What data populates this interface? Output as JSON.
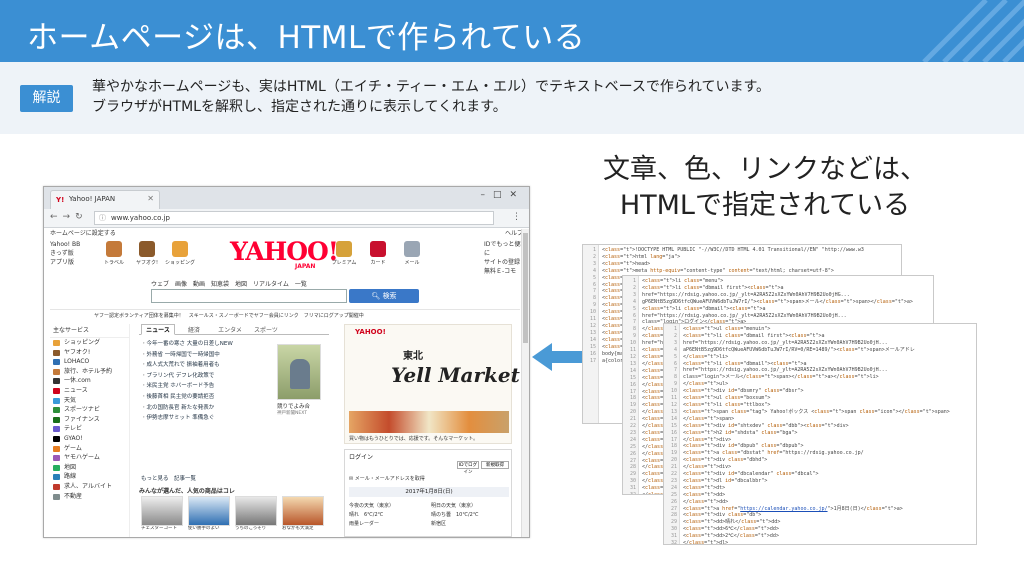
{
  "slide": {
    "title": "ホームページは、HTMLで作られている",
    "badge": "解説",
    "explain_line1": "華やかなホームページも、実はHTML（エイチ・ティー・エム・エル）でテキストベースで作られています。",
    "explain_line2": "ブラウザがHTMLを解釈し、指定された通りに表示してくれます。",
    "caption_line1": "文章、色、リンクなどは、",
    "caption_line2": "HTMLで指定されている"
  },
  "browser": {
    "tab_title": "Yahoo! JAPAN",
    "url": "www.yahoo.co.jp",
    "top_left": "ホームページに設定する",
    "top_right": "ヘルプ",
    "left_links": [
      "Yahoo! BB",
      "きっず版",
      "アプリ版"
    ],
    "services": [
      "トラベル",
      "ヤフオク!",
      "ショッピング",
      "プレミアム",
      "カード",
      "メール"
    ],
    "logo": "YAHOO!",
    "logo_sub": "JAPAN",
    "right_links": [
      "IDでもっと便利に",
      "サイトの登録",
      "無料Ｅ-コモ"
    ],
    "search_tabs": "ウェブ　画像　動画　知恵袋　地図　リアルタイム　一覧",
    "search_button": "検索",
    "promo": "ヤフー認定ボランティア団体を募集中！　スキールス・スノーボードでヤフー会員にリンク　フリマにログアップ開催中",
    "sidebar_head": "主なサービス",
    "sidebar_items": [
      "ショッピング",
      "ヤフオク!",
      "LOHACO",
      "旅行、ホテル予約",
      "一休.com",
      "ニュース",
      "天気",
      "スポーツナビ",
      "ファイナンス",
      "テレビ",
      "GYAO!",
      "ゲーム",
      "ヤモハゲーム",
      "地図",
      "路線",
      "求人、アルバイト",
      "不動産"
    ],
    "news_tabs": [
      "ニュース",
      "経済",
      "エンタメ",
      "スポーツ"
    ],
    "news_items": [
      "今年一番の寒さ 大量の日差しNEW",
      "外務省 一時帰国で一時帰国中",
      "成人式大荒れで 振袖着用者も",
      "プラリン代 デフレ化政策で",
      "米民主党 ホバーボード予告",
      "後藤首相 民主党の要請拒否",
      "北の国防長官 新たな発表か",
      "伊勢志摩サミット 準備急ぐ"
    ],
    "photo_caption": "競りでよみ合",
    "photo_credit": "神戸新聞NEXT",
    "news_more": "もっと見る　記事一覧",
    "popular_title": "みんなが選んだ、人気の商品はコレ",
    "popular_items": [
      "チェスターコート",
      "使い勝手のよい",
      "うちのこっそり",
      "おなかも大満足"
    ],
    "ad_logo": "YAHOO!",
    "ad_tohoku": "東北",
    "ad_title": "Yell Market",
    "ad_caption": "買い物はもうひとりでは、応援です。そんなマーケット。",
    "login_title": "ログイン",
    "login_btn1": "IDでログイン",
    "login_btn2": "新規取得",
    "mail_label": "メール・メールアドレスを取得",
    "date": "2017年1月8日(日)",
    "weather_left": [
      "今夜の天気（東京）",
      "晴れ　6℃/2℃",
      "雨量レーダー"
    ],
    "weather_right": [
      "明日の天気（東京）",
      "晴のち曇　10℃/2℃",
      "新宿区"
    ]
  },
  "code": {
    "c1_lines": [
      "<!DOCTYPE HTML PUBLIC \"-//W3C//DTD HTML 4.01 Transitional//EN\" \"http://www.w3",
      "<html lang=\"ja\">",
      "<head>",
      "<meta http-equiv=\"content-type\" content=\"text/html; charset=utf-8\">",
      "<meta http-equiv=\"content-style-type\" content=\"text/css\">",
      "<meta http-equiv=\"content-script-type\" content=\"text/javascript\">",
      "<meta name=\"description\" content=\"日本最大級のポータルサイト。検索、オークション、ニュース、メール、コミュニティ、ショッピング、など80以上のサー",
      "<meta name=\"robots\" content=\"noodp\">",
      "<meta name=\"google-site-verification\" content=\"fsLMOiigp5fIpsOYNjPS...",
      "<link rel=\"canonical\" href=\"https://www.yahoo.co.jp/\">",
      "<meta property=\"og:title\" content=\"Yahoo! JAPAN\">",
      "<meta property=\"og:type\" content=\"website\">",
      "<meta property=\"og:url\" content=\"https://www.yahoo.co.jp/\">",
      "<title>Yahoo! JAPAN</title>",
      "<style type=\"text/css\">",
      "body{margin:0;padding:0;background:#fff;}",
      "a{color:#1b4fb8;}"
    ],
    "c2_lines": [
      "<li class=\"menu\">",
      "<li class=\"dbmail first\"><a",
      "href=\"https://rdsig.yahoo.co.jp/_ylt=A2RA5Z2sXZxYWn0AhV7H9B2Uo0jHG...",
      "gP6ENtB5zg9D6tfcQWueAFUVW6dbTuJW7rI/\"><span>メール</span></a>",
      "<li class=\"dbmail\"><a",
      "href=\"https://rdsig.yahoo.co.jp/_ylt=A2RA5Z2sXZxYWn0AhV7H9B2Uo0jH...",
      "class=\"login\">ログイン</a>",
      "</li>",
      "<li class=\"dbmail first\"><a",
      "href=\"https://rdsig.yahoo.co.jp/_ylt=A2RA5Z2sXZxYWn0AhV7H9B2Uo0jH...",
      "<div class=\"yjhx\">",
      "<h2 id=\"dbmt\">",
      "</h2>",
      "<div id=\"msthd\" class=\"dbsr\">",
      "<h2 class=\"dbhdt\">",
      "</div>",
      "<div id=\"tabdtl\">",
      "<li>",
      "<a href=\"https://news.yahoo.co.jp/\">",
      "</a>",
      "<div class=\"dblbottom\">",
      "</div>",
      "<dl>",
      "<dd>",
      "</dd>",
      "</dl>",
      "<div>",
      "</div>",
      "<ul>",
      "</ul>",
      "<p>",
      "</p>"
    ],
    "c3_lines": [
      "<ul class=\"menuin\">",
      "<li class=\"dbmail first\"><a",
      "href=\"https://rdsig.yahoo.co.jp/_ylt=A2RA5Z2sXZxYWn0AhV7H9B2Uo0jH...",
      "aP6ENtB5zg9D6tfcQWueAFUVW6dbTuJW7rI/RV=0/RE=1489/\"><span>メールアドレ",
      "</li>",
      "<li class=\"dbmail\"><a",
      "href=\"https://rdsig.yahoo.co.jp/_ylt=A2RA5Z2sXZxYWn0AhV7H9B2Uo0jH...",
      "class=\"login\">メール</span></a></li>",
      "</ul>",
      "<div id=\"dbsmry\" class=\"dbsr\">",
      "<ul class=\"boxsum\">",
      "<li class=\"ttlbox\">",
      "<span class=\"tag\"> Yahoo!ボックス <span class=\"icon\"></span>",
      "</span>",
      "<div id=\"shtxdev\" class=\"dbb\"><div>",
      "<h2 id=\"shdsta\" class=\"bga\">",
      "</div>",
      "<div id=\"dbpub\" class=\"dbpub\">",
      "<a class=\"dbstat\" href=\"https://rdsig.yahoo.co.jp/",
      "<div class=\"dbhd\">",
      "</div>",
      "<div id=\"dbcalendar\" class=\"dbcal\">",
      "<dl id=\"dbcalbbr\">",
      "<dt>",
      "<dd>",
      "</dd>",
      "<a href=\"https://calendar.yahoo.co.jp/\">1月8日(日)</a>",
      "<div class=\"db\">",
      "<dd>晴れ</dd>",
      "<dd>6℃</dd>",
      "<dd>2℃</dd>",
      "</dl>"
    ],
    "gutter_start": 1
  }
}
